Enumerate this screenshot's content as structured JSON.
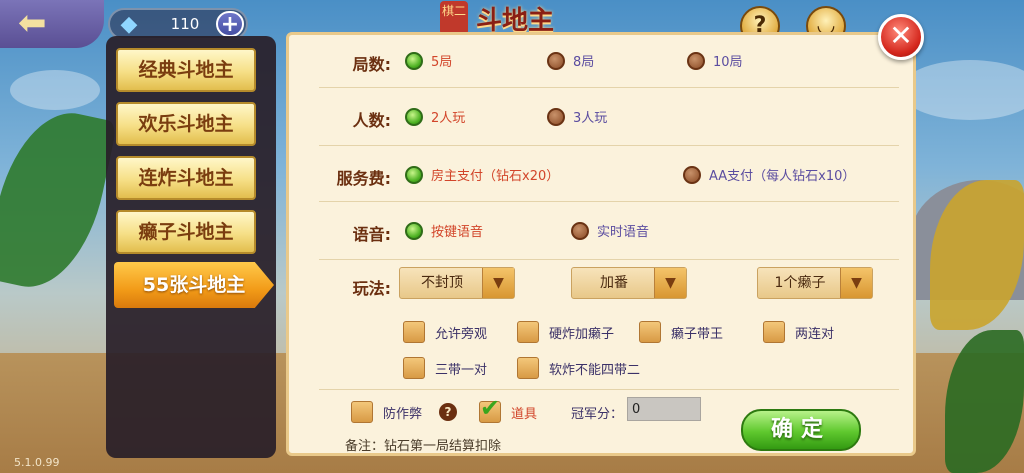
{
  "header": {
    "diamond_count": "110",
    "plus_label": "+",
    "back_icon": "back-arrow-icon",
    "logo_seal": "棋二",
    "logo_text": "斗地主",
    "help_label": "?",
    "face_label": "◡"
  },
  "tabs": [
    {
      "label": "经典斗地主",
      "active": false
    },
    {
      "label": "欢乐斗地主",
      "active": false
    },
    {
      "label": "连炸斗地主",
      "active": false
    },
    {
      "label": "癞子斗地主",
      "active": false
    },
    {
      "label": "55张斗地主",
      "active": true
    }
  ],
  "rounds": {
    "label": "局数:",
    "options": [
      {
        "text": "5局",
        "selected": true
      },
      {
        "text": "8局",
        "selected": false
      },
      {
        "text": "10局",
        "selected": false
      }
    ]
  },
  "players": {
    "label": "人数:",
    "options": [
      {
        "text": "2人玩",
        "selected": true
      },
      {
        "text": "3人玩",
        "selected": false
      }
    ]
  },
  "fee": {
    "label": "服务费:",
    "options": [
      {
        "text": "房主支付（钻石x20）",
        "selected": true
      },
      {
        "text": "AA支付（每人钻石x10）",
        "selected": false
      }
    ]
  },
  "voice": {
    "label": "语音:",
    "options": [
      {
        "text": "按键语音",
        "selected": true
      },
      {
        "text": "实时语音",
        "selected": false
      }
    ]
  },
  "rules": {
    "label": "玩法:",
    "dropdowns": [
      {
        "value": "不封顶"
      },
      {
        "value": "加番"
      },
      {
        "value": "1个癞子"
      }
    ],
    "checkboxes": [
      {
        "text": "允许旁观",
        "checked": false
      },
      {
        "text": "硬炸加癞子",
        "checked": false
      },
      {
        "text": "癞子带王",
        "checked": false
      },
      {
        "text": "两连对",
        "checked": false
      },
      {
        "text": "三带一对",
        "checked": false
      },
      {
        "text": "软炸不能四带二",
        "checked": false
      }
    ]
  },
  "extras": {
    "anti_cheat": {
      "text": "防作弊",
      "checked": false
    },
    "help": "?",
    "props": {
      "text": "道具",
      "checked": true
    },
    "score_label": "冠军分：",
    "score_value": "0",
    "note": "备注：钻石第一局结算扣除"
  },
  "confirm_label": "确定",
  "close_label": "✕",
  "version": "5.1.0.99",
  "colors": {
    "selected_text": "#d2452a",
    "unselected_text": "#5b4da0",
    "label": "#6b2f10",
    "panel_bg": "#fbf2dc",
    "confirm": "#5fc82e"
  }
}
